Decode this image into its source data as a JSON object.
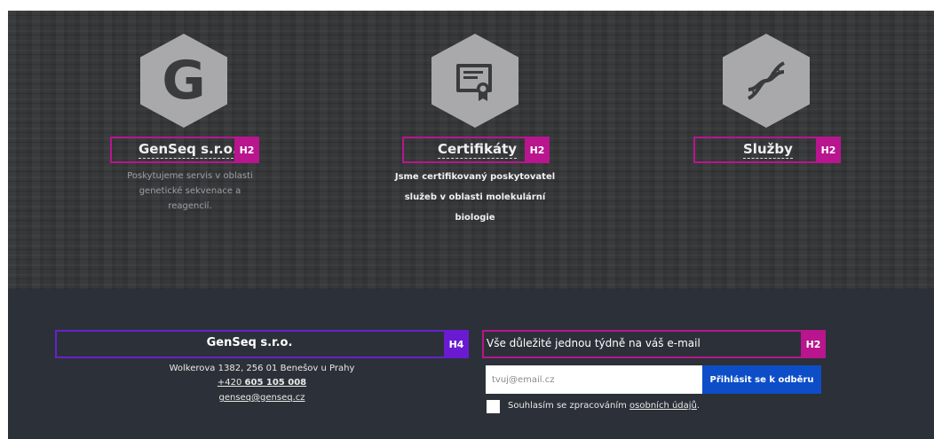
{
  "features": [
    {
      "title": "GenSeq s.r.o.",
      "tag": "H2",
      "icon": "g-letter-icon",
      "description_lines": [
        "Poskytujeme servis v oblasti",
        "genetické sekvenace a",
        "reagencií."
      ]
    },
    {
      "title": "Certifikáty",
      "tag": "H2",
      "icon": "certificate-icon",
      "description_lines": [
        "Jsme certifikovaný poskytovatel",
        "služeb v oblasti molekulární",
        "biologie"
      ]
    },
    {
      "title": "Služby",
      "tag": "H2",
      "icon": "dna-icon",
      "description_lines": []
    }
  ],
  "footer": {
    "company": {
      "title": "GenSeq s.r.o.",
      "tag": "H4",
      "address": "Wolkerova 1382, 256 01 Benešov u Prahy",
      "phone_prefix": "+420 ",
      "phone_number": "605 105 008",
      "email": "genseq@genseq.cz"
    },
    "newsletter": {
      "title": "Vše důležité jednou týdně na váš e-mail",
      "tag": "H2",
      "email_placeholder": "tvuj@email.cz",
      "email_value": "",
      "subscribe_label": "Přihlásit se k odběru",
      "consent_text": "Souhlasím se zpracováním ",
      "consent_link": "osobních údajů",
      "consent_suffix": "."
    }
  },
  "colors": {
    "hero_bg": "#333436",
    "footer_bg": "#2c3038",
    "hex_icon": "#a9a9ab",
    "h2_outline": "#b8158f",
    "h4_outline": "#6a1bd1",
    "subscribe_button": "#0d4ec8"
  }
}
